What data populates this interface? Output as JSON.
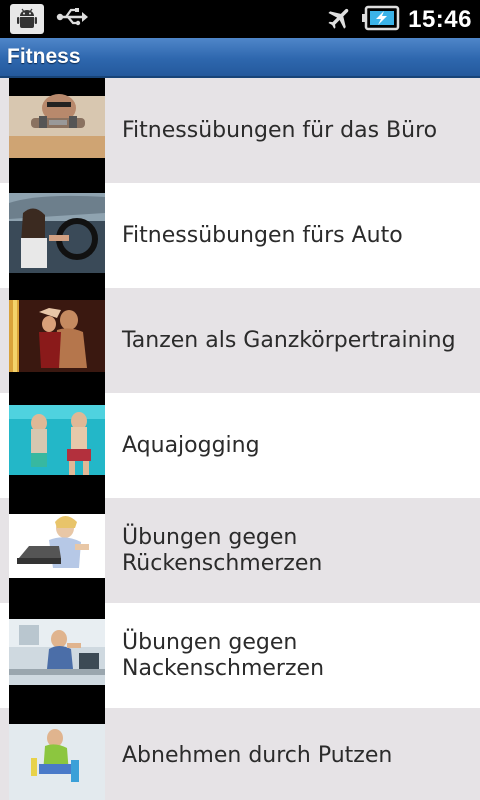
{
  "status_bar": {
    "time": "15:46",
    "icons": [
      "android-debug-icon",
      "usb-icon",
      "airplane-mode-icon",
      "battery-charging-icon"
    ]
  },
  "header": {
    "title": "Fitness"
  },
  "items": [
    {
      "label": "Fitnessübungen für das Büro",
      "thumb": "office-workout-thumbnail"
    },
    {
      "label": "Fitnessübungen fürs Auto",
      "thumb": "car-workout-thumbnail"
    },
    {
      "label": "Tanzen als Ganzkörpertraining",
      "thumb": "dancing-thumbnail"
    },
    {
      "label": "Aquajogging",
      "thumb": "aquajogging-thumbnail"
    },
    {
      "label": "Übungen gegen\nRückenschmerzen",
      "thumb": "back-pain-thumbnail"
    },
    {
      "label": "Übungen gegen\nNackenschmerzen",
      "thumb": "neck-pain-thumbnail"
    },
    {
      "label": "Abnehmen durch Putzen",
      "thumb": "cleaning-thumbnail"
    }
  ],
  "colors": {
    "title_bar": "#2e67ae",
    "row_alt": "#e6e3e6",
    "row": "#ffffff",
    "text": "#2b2b2b"
  }
}
